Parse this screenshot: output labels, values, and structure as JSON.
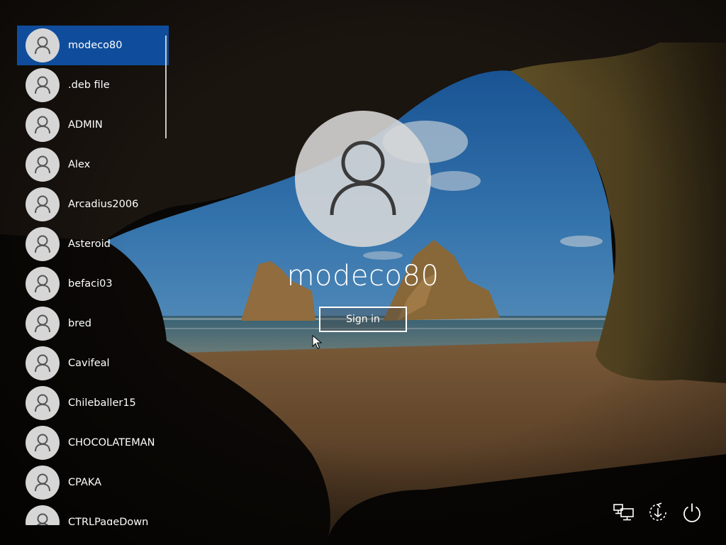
{
  "users": [
    {
      "name": "modeco80",
      "selected": true
    },
    {
      "name": ".deb file"
    },
    {
      "name": "ADMIN"
    },
    {
      "name": "Alex"
    },
    {
      "name": "Arcadius2006"
    },
    {
      "name": "Asteroid"
    },
    {
      "name": "befaci03"
    },
    {
      "name": "bred"
    },
    {
      "name": "Cavifeal"
    },
    {
      "name": "Chileballer15"
    },
    {
      "name": "CHOCOLATEMAN"
    },
    {
      "name": "CPAKA"
    },
    {
      "name": "CTRLPageDown"
    }
  ],
  "signin": {
    "username": "modeco80",
    "button_label": "Sign in"
  },
  "system_buttons": {
    "network_icon": "network-icon",
    "ease_of_access_icon": "ease-of-access-icon",
    "power_icon": "power-icon"
  },
  "colors": {
    "selected_user_bg": "#0f4d9c",
    "avatar_bg": "#d6d6d6"
  }
}
